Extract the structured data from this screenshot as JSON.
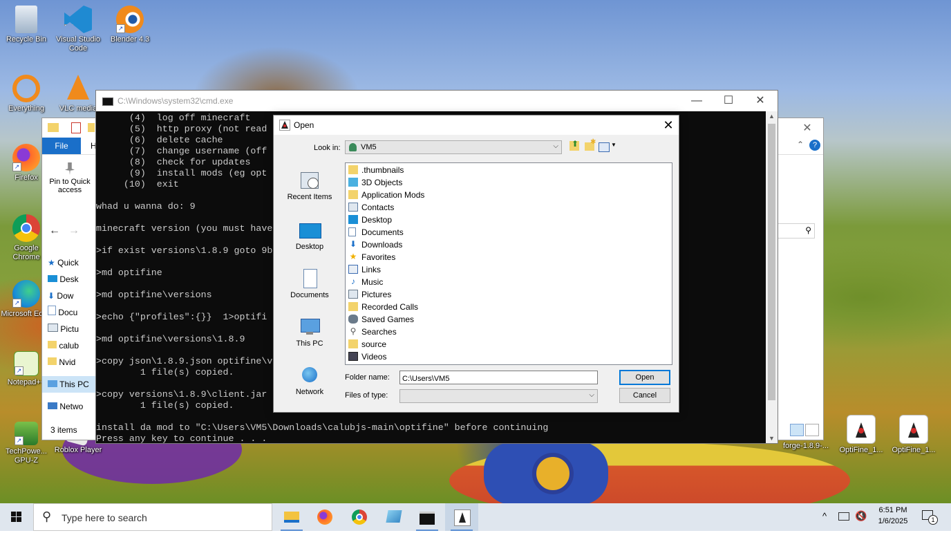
{
  "desktop_icons": [
    {
      "label": "Recycle Bin"
    },
    {
      "label": "Visual Studio Code"
    },
    {
      "label": "Blender 4.3"
    },
    {
      "label": "Everything"
    },
    {
      "label": "VLC media"
    },
    {
      "label": "Firefox"
    },
    {
      "label": "Google Chrome"
    },
    {
      "label": "Microsoft Edge"
    },
    {
      "label": "Notepad++"
    },
    {
      "label": "TechPowe... GPU-Z"
    },
    {
      "label": "Roblox Player"
    },
    {
      "label": "forge-1.8.9-..."
    },
    {
      "label": "OptiFine_1..."
    },
    {
      "label": "OptiFine_1..."
    }
  ],
  "explorer": {
    "file_tab": "File",
    "h_tab": "H",
    "pin_label": "Pin to Quick access",
    "side_items": [
      "Quick",
      "Desk",
      "Dow",
      "Docu",
      "Pictu",
      "calub",
      "Nvid",
      "This PC",
      "Netwo"
    ],
    "status": "3 items"
  },
  "cmd": {
    "title": "C:\\Windows\\system32\\cmd.exe",
    "lines": [
      "      (4)  log off minecraft",
      "      (5)  http proxy (not read",
      "      (6)  delete cache",
      "      (7)  change username (off",
      "      (8)  check for updates",
      "      (9)  install mods (eg opt",
      "     (10)  exit",
      "",
      "whad u wanna do: 9",
      "",
      "minecraft version (you must have",
      "",
      ">if exist versions\\1.8.9 goto 9b",
      "",
      ">md optifine",
      "",
      ">md optifine\\versions",
      "",
      ">echo {\"profiles\":{}}  1>optifi",
      "",
      ">md optifine\\versions\\1.8.9",
      "",
      ">copy json\\1.8.9.json optifine\\v",
      "        1 file(s) copied.",
      "",
      ">copy versions\\1.8.9\\client.jar",
      "        1 file(s) copied.",
      "",
      "install da mod to \"C:\\Users\\VM5\\Downloads\\calubjs-main\\optifine\" before continuing",
      "Press any key to continue . . ."
    ]
  },
  "dialog": {
    "title": "Open",
    "look_in_label": "Look in:",
    "look_in_value": "VM5",
    "places": [
      "Recent Items",
      "Desktop",
      "Documents",
      "This PC",
      "Network"
    ],
    "files": [
      {
        "name": ".thumbnails",
        "icon": "folder-icon"
      },
      {
        "name": "3D Objects",
        "icon": "3d-objects-icon"
      },
      {
        "name": "Application Mods",
        "icon": "folder-icon"
      },
      {
        "name": "Contacts",
        "icon": "contacts-icon"
      },
      {
        "name": "Desktop",
        "icon": "desktop-icon"
      },
      {
        "name": "Documents",
        "icon": "documents-icon"
      },
      {
        "name": "Downloads",
        "icon": "downloads-icon"
      },
      {
        "name": "Favorites",
        "icon": "star-icon"
      },
      {
        "name": "Links",
        "icon": "links-icon"
      },
      {
        "name": "Music",
        "icon": "music-icon"
      },
      {
        "name": "Pictures",
        "icon": "pictures-icon"
      },
      {
        "name": "Recorded Calls",
        "icon": "folder-icon"
      },
      {
        "name": "Saved Games",
        "icon": "saved-games-icon"
      },
      {
        "name": "Searches",
        "icon": "search-icon"
      },
      {
        "name": "source",
        "icon": "folder-icon"
      },
      {
        "name": "Videos",
        "icon": "videos-icon"
      }
    ],
    "folder_name_label": "Folder name:",
    "folder_name_value": "C:\\Users\\VM5",
    "files_of_type_label": "Files of type:",
    "open_button": "Open",
    "cancel_button": "Cancel"
  },
  "taskbar": {
    "search_placeholder": "Type here to search",
    "time": "6:51 PM",
    "date": "1/6/2025",
    "notification_count": "1"
  },
  "colors": {
    "accent": "#0078d7",
    "folder": "#f3d36b",
    "cmd_bg": "#0c0c0c",
    "cmd_fg": "#cccccc"
  }
}
